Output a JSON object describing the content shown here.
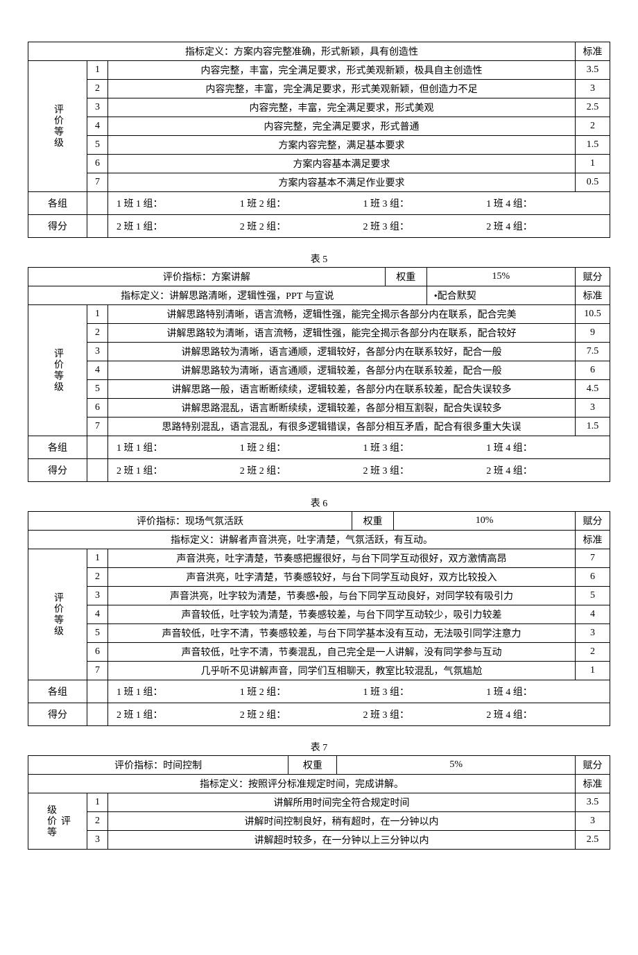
{
  "labels": {
    "definition_prefix": "指标定义：",
    "indicator_prefix": "评价指标：",
    "weight": "权重",
    "score_header": "赋分",
    "standard": "标准",
    "grades_label": "评价等级",
    "group_scores_l1": "各组",
    "group_scores_l2": "得分"
  },
  "groups": {
    "row1": [
      "1 班 1 组：",
      "1 班 2 组：",
      "1 班 3 组：",
      "1 班 4 组："
    ],
    "row2": [
      "2 班 1 组：",
      "2 班 2 组：",
      "2 班 3 组：",
      "2 班 4 组："
    ]
  },
  "tables": [
    {
      "caption": "",
      "definition": "指标定义：方案内容完整准确，形式新颖，具有创造性",
      "levels": [
        {
          "n": "1",
          "desc": "内容完整，丰富，完全满足要求，形式美观新颖，极具自主创造性",
          "score": "3.5"
        },
        {
          "n": "2",
          "desc": "内容完整，丰富，完全满足要求，形式美观新颖，但创造力不足",
          "score": "3"
        },
        {
          "n": "3",
          "desc": "内容完整，丰富，完全满足要求，形式美观",
          "score": "2.5"
        },
        {
          "n": "4",
          "desc": "内容完整，完全满足要求，形式普通",
          "score": "2"
        },
        {
          "n": "5",
          "desc": "方案内容完整，满足基本要求",
          "score": "1.5"
        },
        {
          "n": "6",
          "desc": "方案内容基本满足要求",
          "score": "1"
        },
        {
          "n": "7",
          "desc": "方案内容基本不满足作业要求",
          "score": "0.5"
        }
      ]
    },
    {
      "caption": "表 5",
      "indicator": "评价指标：方案讲解",
      "weight": "15%",
      "definition_left": "指标定义：讲解思路清晰，逻辑性强，PPT 与宣说",
      "definition_right": "•配合默契",
      "levels": [
        {
          "n": "1",
          "desc": "讲解思路特别清晰，语言流畅，逻辑性强，能完全揭示各部分内在联系，配合完美",
          "score": "10.5"
        },
        {
          "n": "2",
          "desc": "讲解思路较为清晰，语言流畅，逻辑性强，能完全揭示各部分内在联系，配合较好",
          "score": "9"
        },
        {
          "n": "3",
          "desc": "讲解思路较为清晰，语言通顺，逻辑较好，各部分内在联系较好，配合一般",
          "score": "7.5"
        },
        {
          "n": "4",
          "desc": "讲解思路较为清晰，语言通顺，逻辑较差，各部分内在联系较差，配合一般",
          "score": "6"
        },
        {
          "n": "5",
          "desc": "讲解思路一般，语言断断续续，逻辑较差，各部分内在联系较差，配合失误较多",
          "score": "4.5"
        },
        {
          "n": "6",
          "desc": "讲解思路混乱，语言断断续续，逻辑较差，各部分相互割裂，配合失误较多",
          "score": "3"
        },
        {
          "n": "7",
          "desc": "思路特别混乱，语言混乱，有很多逻辑错误，各部分相互矛盾，配合有很多重大失误",
          "score": "1.5"
        }
      ]
    },
    {
      "caption": "表 6",
      "indicator": "评价指标：现场气氛活跃",
      "weight": "10%",
      "definition": "指标定义：讲解者声音洪亮，吐字清楚，气氛活跃，有互动。",
      "levels": [
        {
          "n": "1",
          "desc": "声音洪亮，吐字清楚，节奏感把握很好，与台下同学互动很好，双方激情高昂",
          "score": "7"
        },
        {
          "n": "2",
          "desc": "声音洪亮，吐字清楚，节奏感较好，与台下同学互动良好，双方比较投入",
          "score": "6"
        },
        {
          "n": "3",
          "desc": "声音洪亮，吐字较为清楚，节奏感•般，与台下同学互动良好，对同学较有吸引力",
          "score": "5"
        },
        {
          "n": "4",
          "desc": "声音较低，吐字较为清楚，节奏感较差，与台下同学互动较少，吸引力较差",
          "score": "4"
        },
        {
          "n": "5",
          "desc": "声音较低，吐字不清，节奏感较差，与台下同学基本没有互动，无法吸引同学注意力",
          "score": "3"
        },
        {
          "n": "6",
          "desc": "声音较低，吐字不清，节奏混乱，自己完全是一人讲解，没有同学参与互动",
          "score": "2"
        },
        {
          "n": "7",
          "desc": "几乎听不见讲解声音，同学们互相聊天，教室比较混乱，气氛尴尬",
          "score": "1"
        }
      ]
    },
    {
      "caption": "表 7",
      "indicator": "评价指标：时间控制",
      "weight": "5%",
      "definition": "指标定义：按照评分标准规定时间，完成讲解。",
      "partial_levels": [
        {
          "n": "1",
          "desc": "讲解所用时间完全符合规定时间",
          "score": "3.5"
        },
        {
          "n": "2",
          "desc": "讲解时间控制良好，稍有超时，在一分钟以内",
          "score": "3"
        },
        {
          "n": "3",
          "desc": "讲解超时较多，在一分钟以上三分钟以内",
          "score": "2.5"
        }
      ]
    }
  ]
}
